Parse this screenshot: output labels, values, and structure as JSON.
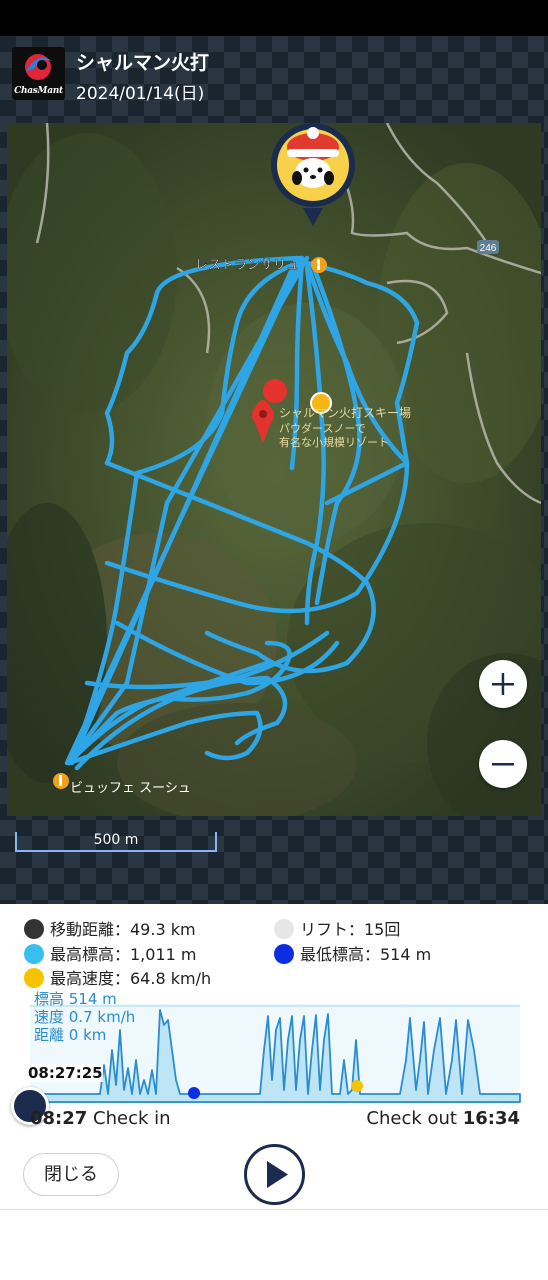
{
  "app": {
    "logo_text": "ChasMant",
    "resort_name": "シャルマン火打",
    "date": "2024/01/14(日)"
  },
  "map": {
    "pins": {
      "restaurant_top": "レストランサリュ",
      "resort_line1": "シャルマン火打スキー場",
      "resort_line2": "パウダースノーで",
      "resort_line3": "有名な小規模リゾート",
      "buffet": "ビュッフェ スーシュ",
      "road_number": "246"
    },
    "scale_label": "500 m",
    "zoom_in_icon": "plus-icon",
    "zoom_out_icon": "minus-icon"
  },
  "stats": {
    "distance": "移動距離：49.3 km",
    "lifts": "リフト：15回",
    "max_altitude": "最高標高：1,011 m",
    "min_altitude": "最低標高：514 m",
    "max_speed": "最高速度：64.8 km/h",
    "colors": {
      "distance": "#333333",
      "lifts": "#e6e6e6",
      "max_altitude": "#35c0f0",
      "min_altitude": "#0a2fe0",
      "max_speed": "#f5c400"
    }
  },
  "chart_info": {
    "altitude": "標高 514 m",
    "speed": "速度 0.7 km/h",
    "distance": "距離 0 km",
    "current_time": "08:27:25"
  },
  "timeline": {
    "checkin_time": "08:27",
    "checkin_label": " Check in",
    "checkout_label": "Check out ",
    "checkout_time": "16:34"
  },
  "buttons": {
    "close": "閉じる",
    "play_icon": "play-icon"
  }
}
